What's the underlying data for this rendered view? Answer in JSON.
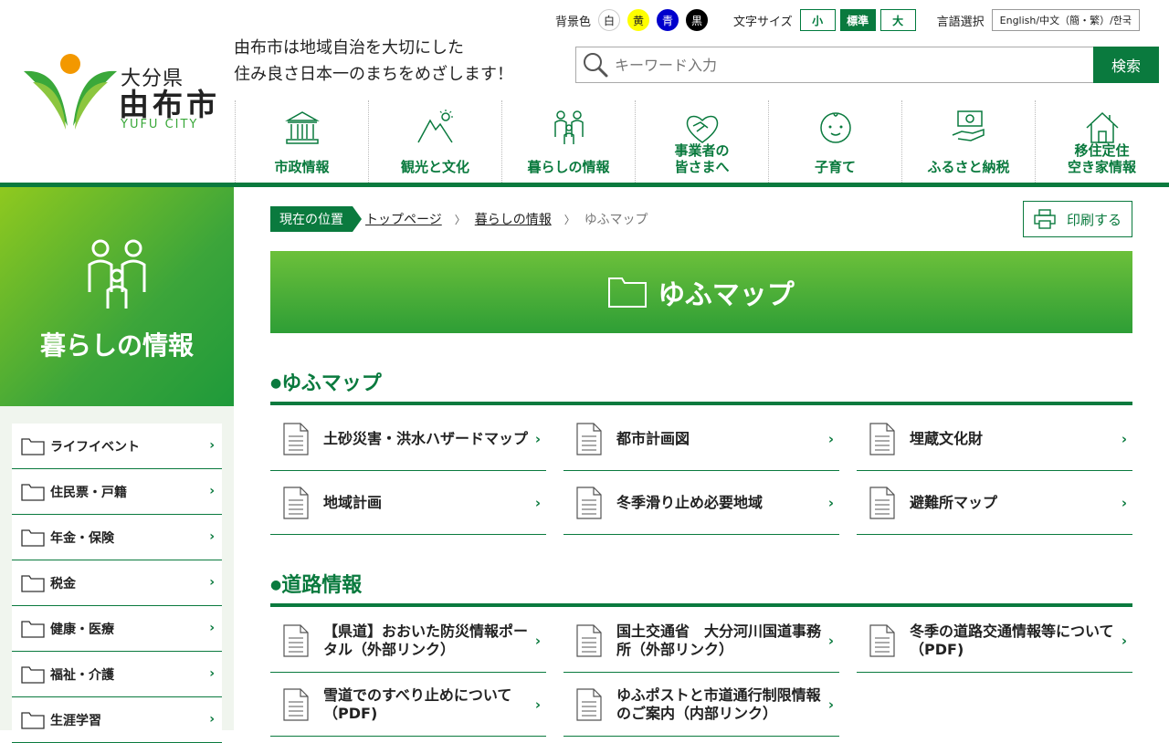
{
  "header": {
    "logo": {
      "pref": "大分県",
      "city": "由布市",
      "en": "YUFU CITY"
    },
    "slogan": [
      "由布市は地域自治を大切にした",
      "住み良さ日本一のまちをめざします！"
    ],
    "bg": {
      "label": "背景色",
      "options": [
        {
          "label": "白",
          "bg": "#ffffff",
          "fg": "#222222"
        },
        {
          "label": "黄",
          "bg": "#ffff00",
          "fg": "#222222"
        },
        {
          "label": "青",
          "bg": "#0000cc",
          "fg": "#ffffff"
        },
        {
          "label": "黒",
          "bg": "#000000",
          "fg": "#ffffff"
        }
      ]
    },
    "font_size": {
      "label": "文字サイズ",
      "small": "小",
      "standard": "標準",
      "large": "大"
    },
    "lang": {
      "label": "言語選択",
      "value": "English/中文（簡・繁）/한국"
    },
    "search": {
      "placeholder": "キーワード入力",
      "button": "検索"
    },
    "nav": [
      {
        "label": "市政情報",
        "icon": "city-hall-icon"
      },
      {
        "label": "観光と文化",
        "icon": "mountain-sun-icon"
      },
      {
        "label": "暮らしの情報",
        "icon": "family-icon"
      },
      {
        "label": "事業者の\n皆さまへ",
        "icon": "handshake-icon"
      },
      {
        "label": "子育て",
        "icon": "baby-face-icon"
      },
      {
        "label": "ふるさと納税",
        "icon": "money-hand-icon"
      },
      {
        "label": "移住定住\n空き家情報",
        "icon": "house-icon"
      }
    ]
  },
  "sidebar": {
    "title": "暮らしの情報",
    "items": [
      {
        "label": "ライフイベント"
      },
      {
        "label": "住民票・戸籍"
      },
      {
        "label": "年金・保険"
      },
      {
        "label": "税金"
      },
      {
        "label": "健康・医療"
      },
      {
        "label": "福祉・介護"
      },
      {
        "label": "生涯学習"
      }
    ],
    "arrow": "›"
  },
  "breadcrumb": {
    "here": "現在の位置",
    "links": [
      "トップページ",
      "暮らしの情報"
    ],
    "sep": "〉",
    "current": "ゆふマップ"
  },
  "print": "印刷する",
  "page_title": "ゆふマップ",
  "sections": [
    {
      "title": "ゆふマップ",
      "items": [
        {
          "label": "土砂災害・洪水ハザードマップ"
        },
        {
          "label": "都市計画図"
        },
        {
          "label": "埋蔵文化財"
        },
        {
          "label": "地域計画"
        },
        {
          "label": "冬季滑り止め必要地域"
        },
        {
          "label": "避難所マップ"
        }
      ]
    },
    {
      "title": "道路情報",
      "items": [
        {
          "label": "【県道】おおいた防災情報ポータル（外部リンク）"
        },
        {
          "label": "国土交通省　大分河川国道事務所（外部リンク）"
        },
        {
          "label": "冬季の道路交通情報等について（PDF)"
        },
        {
          "label": "雪道でのすべり止めについて（PDF)"
        },
        {
          "label": "ゆふポストと市道通行制限情報のご案内（内部リンク）"
        }
      ]
    }
  ],
  "colors": {
    "primary": "#0a7a3e",
    "accent": "#3ca53a",
    "logo_orange": "#f39800"
  }
}
